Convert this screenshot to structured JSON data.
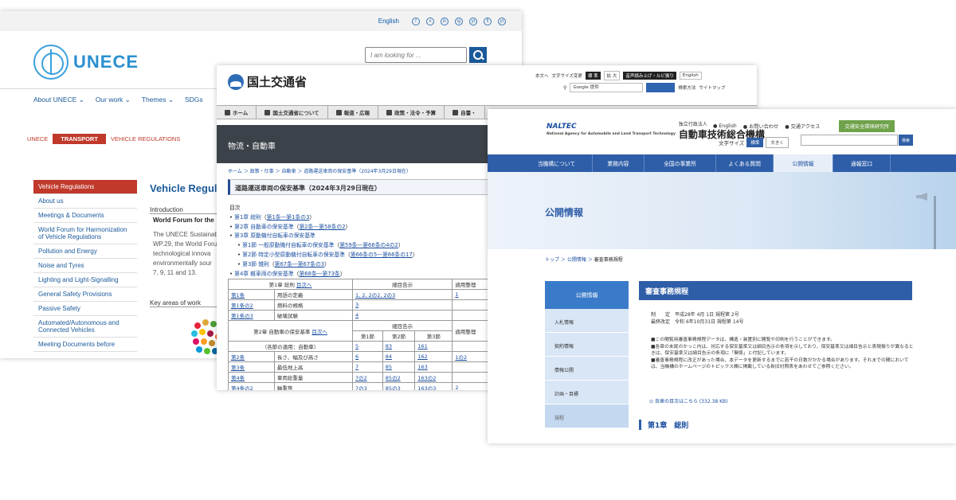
{
  "unece": {
    "lang": "English",
    "social_icons": [
      "f",
      "x",
      "in",
      "ig",
      "yt",
      "fl",
      "yt"
    ],
    "logo_text": "UNECE",
    "search_placeholder": "I am looking for ...",
    "nav": [
      "About UNECE ⌄",
      "Our work ⌄",
      "Themes ⌄",
      "SDGs"
    ],
    "breadcrumb": [
      "UNECE",
      "TRANSPORT",
      "VEHICLE REGULATIONS"
    ],
    "sidebar": [
      "Vehicle Regulations",
      "About us",
      "Meetings & Documents",
      "World Forum for Harmonization of Vehicle Regulations",
      "Pollution and Energy",
      "Noise and Tyres",
      "Lighting and Light-Signalling",
      "General Safety Provisions",
      "Passive Safety",
      "Automated/Autonomous and Connected Vehicles",
      "Meeting Documents before"
    ],
    "main_title": "Vehicle Regulat",
    "intro_heading": "Introduction",
    "world_forum": "World Forum for the",
    "body_lines": [
      "The UNECE Sustainab",
      "WP.29, the World Foru",
      "technological innova",
      "environmentally sour",
      "7, 9, 11 and 13."
    ],
    "key_areas": "Key areas of work",
    "dot_colors": [
      "#e5243b",
      "#dda63a",
      "#4c9f38",
      "#c5192d",
      "#26bde2",
      "#fcc30b",
      "#a21942",
      "#fd6925",
      "#dd1367",
      "#fd9d24",
      "#bf8b2e",
      "#3f7e44",
      "#0a97d9",
      "#56c02b",
      "#00689d",
      "#19486a"
    ]
  },
  "mlit": {
    "logo_text": "国土交通省",
    "util": [
      "本文へ",
      "文字サイズ変更",
      "標 準",
      "拡 大",
      "音声読み上げ・ルビ振り",
      "English"
    ],
    "google_label": "Google",
    "google_placeholder": "提供",
    "search_links": [
      "検索方法",
      "サイトマップ"
    ],
    "nav": [
      "ホーム",
      "国土交通省について",
      "報道・広報",
      "政策・法令・予算",
      "自書・"
    ],
    "banner": "物流・自動車",
    "breadcrumb": "ホーム ＞ 政策・仕事 ＞ 自動車 ＞ 道路運送車両の保安基準（2024年3月29日現在）",
    "title": "道路運送車両の保安基準（2024年3月29日現在）",
    "toc_label": "目次",
    "toc": [
      {
        "pre": "第1章 総則",
        "link": "第1条―第1条の3"
      },
      {
        "pre": "第2章 自動車の保安基準",
        "link": "第2条―第58条の2"
      },
      {
        "pre": "第3章 原動機付自転車の保安基準",
        "link": ""
      },
      {
        "pre": "第1節 一般原動機付自転車の保安基準",
        "link": "第59条―第66条の4の2",
        "sub": true
      },
      {
        "pre": "第2節 特定小型原動機付自転車の保安基準",
        "link": "第66条の5―第66条の17",
        "sub": true
      },
      {
        "pre": "第3節 雑則",
        "link": "第67条―第67条の3",
        "sub": true
      },
      {
        "pre": "第4章 軽車両の保安基準",
        "link": "第68条―第73条"
      }
    ],
    "table": {
      "ch1_head": "第1章 総則",
      "to_toc": "目次へ",
      "detail": "細目告示",
      "apply": "適用整理",
      "rows1": [
        [
          "第1条",
          "用語の定義",
          "1, 2, 2の2, 2の3",
          "1"
        ],
        [
          "第1条の2",
          "燃料の規格",
          "3",
          ""
        ],
        [
          "第1条の3",
          "破壊試験",
          "4",
          ""
        ]
      ],
      "ch2_head": "第2章 自動車の保安基準",
      "sections": [
        "第1節",
        "第2節",
        "第3節"
      ],
      "general": "（各節の適用：自動車）",
      "general_vals": [
        "5",
        "83",
        "161"
      ],
      "rows2": [
        [
          "第2条",
          "長さ、幅及び高さ",
          "6",
          "84",
          "162",
          "1の2"
        ],
        [
          "第3条",
          "最低地上高",
          "7",
          "85",
          "163",
          ""
        ],
        [
          "第4条",
          "車両総重量",
          "7の2",
          "85の2",
          "163の2",
          ""
        ],
        [
          "第4条の2",
          "軸重等",
          "7の3",
          "85の3",
          "163の3",
          "2"
        ]
      ]
    }
  },
  "naltec": {
    "logo_mark": "NALTEC",
    "logo_sub": "National Agency for Automobile and Land Transport Technology",
    "org_small": "独立行政法人",
    "org": "自動車技術総合機構",
    "links": [
      "English",
      "お問い合わせ",
      "交通アクセス"
    ],
    "green_button": "交通安全環境研究所",
    "font_size_label": "文字サイズ",
    "font_std": "標準",
    "font_big": "大きく",
    "search_btn": "検索",
    "nav": [
      "当機構について",
      "業務内容",
      "全国の事業所",
      "よくある質問",
      "公開情報",
      "通報窓口"
    ],
    "nav_selected": 4,
    "hero_title": "公開情報",
    "breadcrumb": [
      "トップ",
      "公開情報",
      "審査事務規程"
    ],
    "side_head": "公開情報",
    "side_items": [
      "入札情報",
      "契約情報",
      "情報公開",
      "計画・目標",
      "規程"
    ],
    "h2": "審査事務規程",
    "enact_label": "制　　定",
    "enact_value": "平成28年 4月 1日 規程第 2号",
    "revise_label": "最終改定",
    "revise_value": "令和 6年10月31日 規程第 14号",
    "notes": [
      "■この閲覧用審査事務規程データは、構造・装置別に閲覧や印刷を行うことができます。",
      "■各章の末尾のかっこ内は、対応する保安基準又は細目告示の条項を示しており、保安基準又は細目告示と表現振りが異なるときは、保安基準又は細目告示の条項に「関係」と付記しています。",
      "■審査事務規程に改正があった場合、本データを更新するまでに若干の日数がかかる場合があります。それまでの間においては、当機構のホームページのトピックス欄に掲載している新旧対照表をあわせてご参照ください。"
    ],
    "download": "各章の目次はこちら (332.38 KB)",
    "chapter": "第1章　総則"
  }
}
